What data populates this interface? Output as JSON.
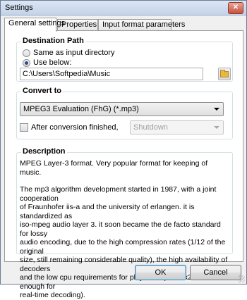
{
  "window": {
    "title": "Settings"
  },
  "tabs": [
    {
      "label": "General settings",
      "active": true
    },
    {
      "label": "Properties",
      "active": false
    },
    {
      "label": "Input format parameters",
      "active": false
    }
  ],
  "destination": {
    "legend": "Destination Path",
    "option_same": "Same as input directory",
    "option_below": "Use below:",
    "selected": "Use below:",
    "path": "C:\\Users\\Softpedia\\Music"
  },
  "convert": {
    "legend": "Convert to",
    "format": "MPEG3 Evaluation (FhG) (*.mp3)",
    "after_label": "After conversion finished,",
    "after_checked": false,
    "after_action": "Shutdown"
  },
  "description": {
    "legend": "Description",
    "lines": [
      "MPEG Layer-3 format.  Very popular format for keeping of music.",
      "",
      "The mp3 algorithm development started in 1987, with a joint cooperation",
      "of Fraunhofer iis-a and the university of erlangen. it is standardized as",
      "iso-mpeg audio layer 3. it soon became the de facto standard for lossy",
      "audio encoding, due to the high compression rates (1/12 of the original",
      "size, still remaining considerable quality), the high availability of decoders",
      "and the low cpu requirements for playback. (486 dx2-66 is enough for",
      "real-time decoding)."
    ]
  },
  "buttons": {
    "ok": "OK",
    "cancel": "Cancel"
  },
  "icons": {
    "close": "close-icon",
    "folder": "folder-icon",
    "dropdown": "chevron-down-icon"
  }
}
